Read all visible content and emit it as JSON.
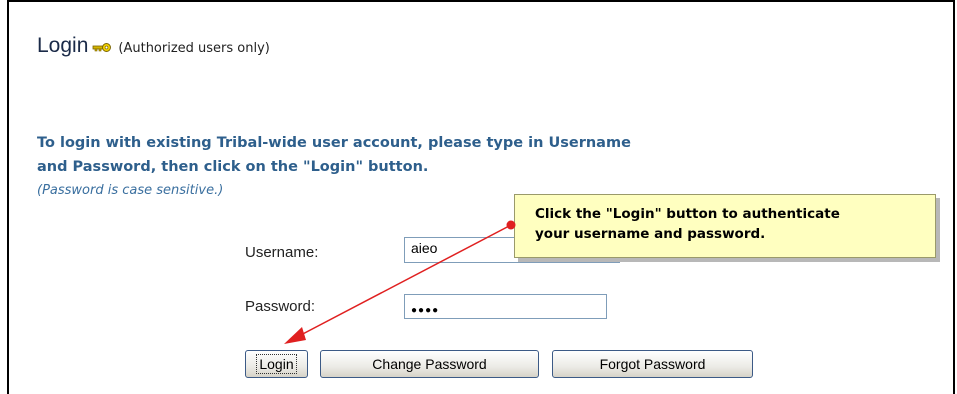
{
  "header": {
    "title": "Login",
    "subtitle": "(Authorized users only)",
    "icon": "key-icon"
  },
  "instructions": {
    "line1": "To login with existing Tribal-wide user account, please type in Username",
    "line2": "and Password, then click on the \"Login\" button.",
    "note": "(Password is case sensitive.)"
  },
  "form": {
    "username_label": "Username:",
    "username_value": "aieo",
    "password_label": "Password:",
    "password_masked": "●●●●"
  },
  "buttons": {
    "login": "Login",
    "change_password": "Change Password",
    "forgot_password": "Forgot Password"
  },
  "callout": {
    "line1": "Click the \"Login\" button to authenticate",
    "line2": "your username and password."
  },
  "colors": {
    "heading_blue": "#2e5f8c",
    "callout_bg": "#ffffc0",
    "arrow_red": "#e02020"
  }
}
